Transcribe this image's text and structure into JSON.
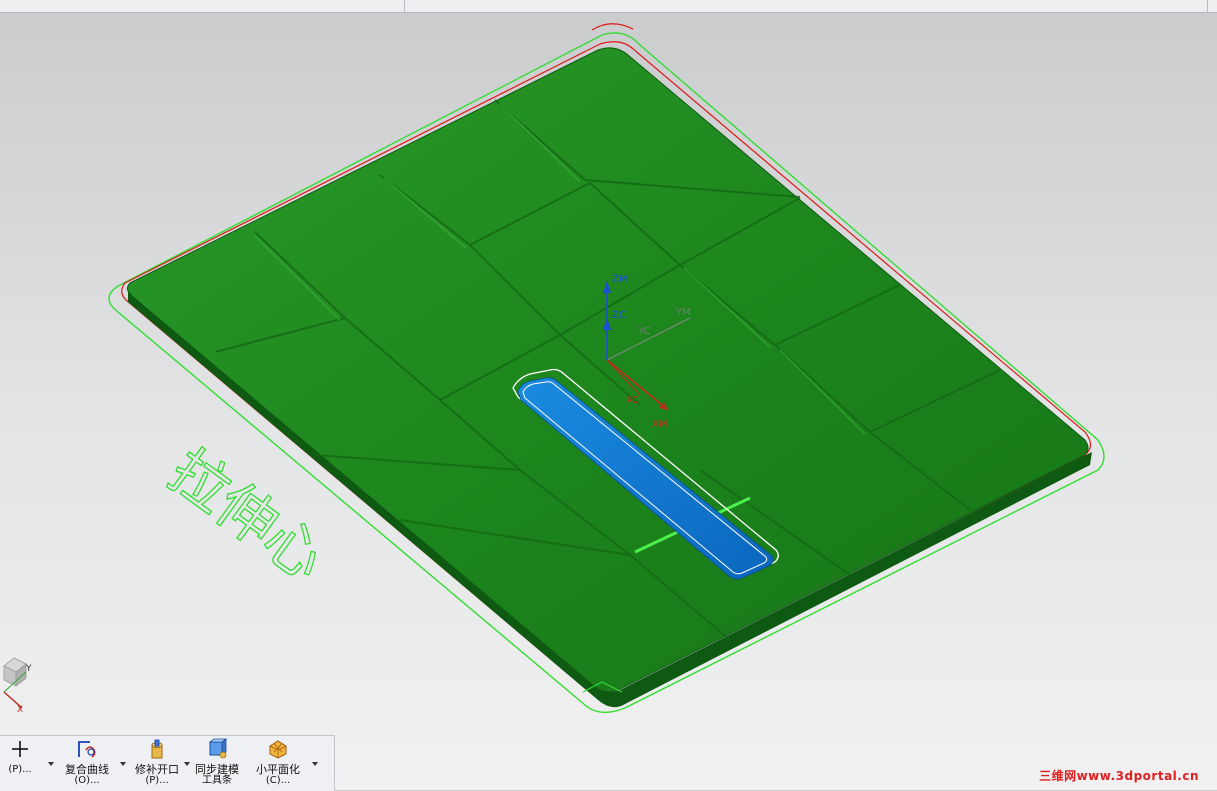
{
  "toolbar": {
    "items": [
      {
        "label": "",
        "sub": "(P)...",
        "icon": "plus-icon"
      },
      {
        "label": "复合曲线",
        "sub": "(O)...",
        "icon": "composite-curve-icon"
      },
      {
        "label": "修补开口",
        "sub": "(P)...",
        "icon": "patch-opening-icon"
      },
      {
        "label": "同步建模",
        "sub": "工具条",
        "icon": "synchronous-modeling-icon"
      },
      {
        "label": "小平面化",
        "sub": "(C)...",
        "icon": "facet-icon"
      }
    ]
  },
  "viewport": {
    "annotation": "拉伸心",
    "wcs_labels": {
      "zm": "ZM",
      "zc": "ZC",
      "yc": "YC",
      "ym": "YM",
      "xc": "XC",
      "xm": "XM"
    },
    "view_triad": {
      "y": "Y",
      "x": "X"
    },
    "colors": {
      "part_green": "#1e8a1e",
      "part_dark": "#0f5a12",
      "outline_green": "#33dd33",
      "outline_red": "#e01818",
      "slot_blue": "#0a72c8",
      "axis_blue": "#1a4fd6",
      "axis_red": "#c0281e"
    }
  },
  "watermark": "三维网www.3dportal.cn"
}
